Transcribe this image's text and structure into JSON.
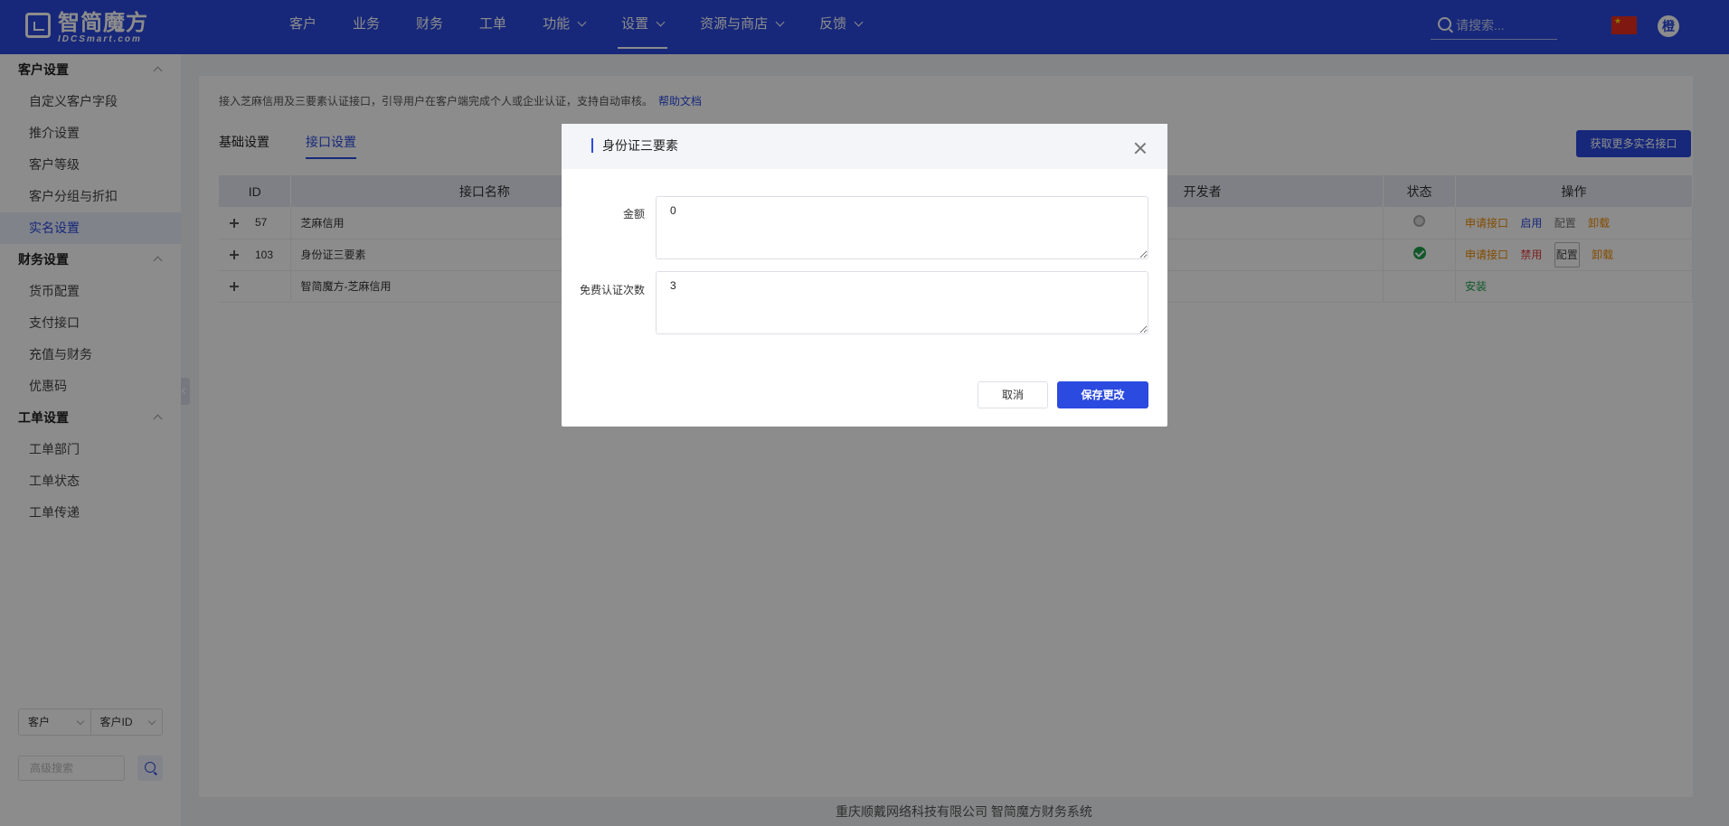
{
  "header": {
    "logo_text": "智简魔方",
    "logo_sub": "IDCSmart.com",
    "nav": [
      {
        "label": "客户"
      },
      {
        "label": "业务"
      },
      {
        "label": "财务"
      },
      {
        "label": "工单"
      },
      {
        "label": "功能"
      },
      {
        "label": "设置"
      },
      {
        "label": "资源与商店"
      },
      {
        "label": "反馈"
      }
    ],
    "search_placeholder": "请搜索...",
    "avatar": "橙"
  },
  "sidebar": {
    "groups": [
      {
        "title": "客户设置",
        "items": [
          "自定义客户字段",
          "推介设置",
          "客户等级",
          "客户分组与折扣",
          "实名设置"
        ]
      },
      {
        "title": "财务设置",
        "items": [
          "货币配置",
          "支付接口",
          "充值与财务",
          "优惠码"
        ]
      },
      {
        "title": "工单设置",
        "items": [
          "工单部门",
          "工单状态",
          "工单传递"
        ]
      }
    ],
    "search_type": "客户",
    "search_field": "客户ID",
    "adv_search_placeholder": "高级搜索"
  },
  "main": {
    "intro": "接入芝麻信用及三要素认证接口，引导用户在客户端完成个人或企业认证，支持自动审核。",
    "help_link": "帮助文档",
    "tabs": [
      "基础设置",
      "接口设置"
    ],
    "more_button": "获取更多实名接口",
    "table": {
      "headers": [
        "ID",
        "接口名称",
        "",
        "开发者",
        "状态",
        "操作"
      ],
      "rows": [
        {
          "id": "57",
          "name": "芝麻信用",
          "ops": [
            "申请接口",
            "启用",
            "配置",
            "卸载"
          ]
        },
        {
          "id": "103",
          "name": "身份证三要素",
          "ops": [
            "申请接口",
            "禁用",
            "配置",
            "卸载"
          ]
        },
        {
          "id": "",
          "name": "智简魔方-芝麻信用",
          "ops": [
            "安装"
          ]
        }
      ]
    }
  },
  "footer": "重庆顺戴网络科技有限公司 智简魔方财务系统",
  "modal": {
    "title": "身份证三要素",
    "fields": [
      {
        "label": "金额",
        "value": "0"
      },
      {
        "label": "免费认证次数",
        "value": "3"
      }
    ],
    "cancel": "取消",
    "save": "保存更改"
  }
}
